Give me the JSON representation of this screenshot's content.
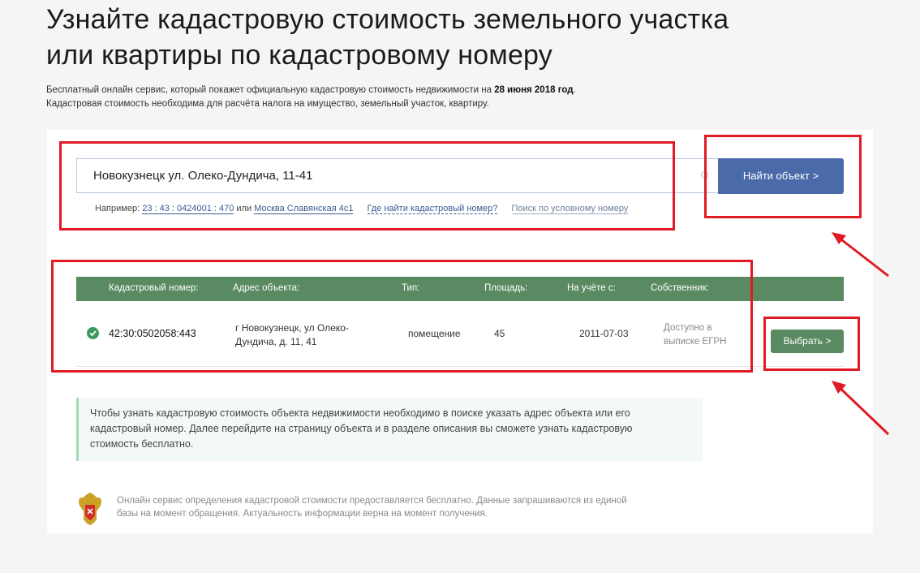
{
  "header": {
    "title_line1": "Узнайте кадастровую стоимость земельного участка",
    "title_line2": "или квартиры по кадастровому номеру",
    "subtitle_line1_prefix": "Бесплатный онлайн сервис, который покажет официальную кадастровую стоимость недвижимости на ",
    "subtitle_line1_date": "28 июня 2018 год",
    "subtitle_line1_suffix": ".",
    "subtitle_line2": "Кадастровая стоимость необходима для расчёта налога на имущество, земельный участок, квартиру."
  },
  "search": {
    "value": "Новокузнецк ул. Олеко-Дундича, 11-41",
    "button_label": "Найти объект >",
    "hint_prefix": "Например: ",
    "hint_example_number": "23 : 43 : 0424001 : 470",
    "hint_or": " или ",
    "hint_example_address": "Москва Славянская 4с1",
    "hint_where_link": "Где найти кадастровый номер?",
    "hint_conditional_link": "Поиск по условному номеру"
  },
  "table": {
    "columns": [
      "Кадастровый номер:",
      "Адрес объекта:",
      "Тип:",
      "Площадь:",
      "На учёте с:",
      "Собственник:"
    ],
    "rows": [
      {
        "number": "42:30:0502058:443",
        "address_line1": "г Новокузнецк, ул Олеко-",
        "address_line2": "Дундича, д. 11, 41",
        "type": "помещение",
        "area": "45",
        "registered": "2011-07-03",
        "owner_line1": "Доступно в",
        "owner_line2": "выписке ЕГРН",
        "select_label": "Выбрать >"
      }
    ]
  },
  "info": {
    "line1": "Чтобы узнать кадастровую стоимость объекта недвижимости необходимо в поиске указать адрес объекта или его",
    "line2": "кадастровый номер. Далее перейдите на страницу объекта и в разделе описания вы сможете узнать кадастровую",
    "line3": "стоимость бесплатно."
  },
  "footer": {
    "line1": "Онлайн сервис определения кадастровой стоимости предоставляется бесплатно. Данные запрашиваются из единой",
    "line2": "базы на момент обращения. Актуальность информации верна на момент получения."
  },
  "colors": {
    "accent_blue": "#4a6aa9",
    "table_green": "#5a8a62",
    "annotation_red": "#e01b24"
  }
}
